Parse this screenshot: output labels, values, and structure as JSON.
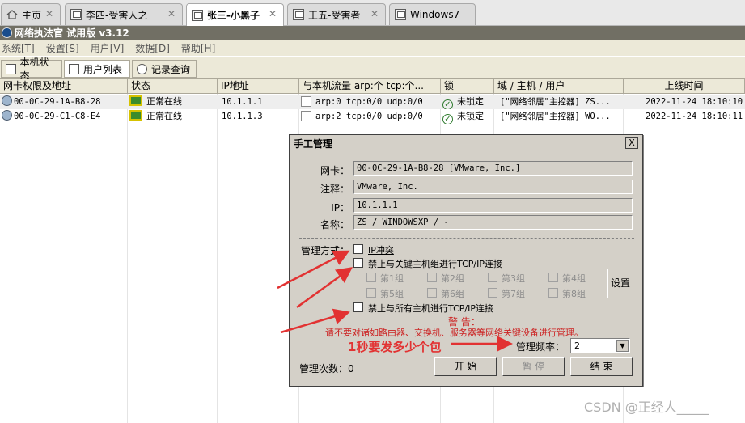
{
  "tabs": [
    {
      "label": "主页",
      "icon": "home-icon",
      "active": false
    },
    {
      "label": "李四-受害人之一",
      "icon": "vm-icon",
      "active": false
    },
    {
      "label": "张三-小黑子",
      "icon": "vm-icon",
      "active": true
    },
    {
      "label": "王五-受害者",
      "icon": "vm-icon",
      "active": false
    },
    {
      "label": "Windows7",
      "icon": "vm-icon",
      "active": false
    }
  ],
  "app": {
    "title": "网络执法官 试用版 v3.12"
  },
  "menu": [
    "系统[T]",
    "设置[S]",
    "用户[V]",
    "数据[D]",
    "帮助[H]"
  ],
  "toolbar": [
    "本机状态",
    "用户列表",
    "记录查询"
  ],
  "table": {
    "columns": [
      "网卡权限及地址",
      "状态",
      "IP地址",
      "与本机流量 arp:个 tcp:个...",
      "锁",
      "域 / 主机 / 用户",
      "上线时间"
    ],
    "rows": [
      {
        "mac": "00-0C-29-1A-B8-28",
        "status": "正常在线",
        "ip": "10.1.1.1",
        "traffic": "arp:0 tcp:0/0 udp:0/0",
        "lock": "未锁定",
        "host": "[\"网络邻居\"主控器] ZS...",
        "time": "2022-11-24 18:10:10"
      },
      {
        "mac": "00-0C-29-C1-C8-E4",
        "status": "正常在线",
        "ip": "10.1.1.3",
        "traffic": "arp:2 tcp:0/0 udp:0/0",
        "lock": "未锁定",
        "host": "[\"网络邻居\"主控器] WO...",
        "time": "2022-11-24 18:10:11"
      }
    ]
  },
  "dialog": {
    "title": "手工管理",
    "close": "X",
    "nic_label": "网卡：",
    "nic_value": "00-0C-29-1A-B8-28 [VMware, Inc.]",
    "note_label": "注释：",
    "note_value": "VMware, Inc.",
    "ip_label": "IP：",
    "ip_value": "10.1.1.1",
    "name_label": "名称：",
    "name_value": "ZS / WINDOWSXP / -",
    "mode_label": "管理方式：",
    "opt_ip_conflict": "IP冲突",
    "opt_block_key": "禁止与关键主机组进行TCP/IP连接",
    "groups": [
      "第1组",
      "第2组",
      "第3组",
      "第4组",
      "第5组",
      "第6组",
      "第7组",
      "第8组"
    ],
    "settings_button": "设置",
    "opt_block_all": "禁止与所有主机进行TCP/IP连接",
    "warn_title": "警 告：",
    "warn_text": "请不要对诸如路由器、交换机、服务器等网络关键设备进行管理。",
    "freq_label": "管理频率：",
    "freq_value": "2",
    "count_label": "管理次数：",
    "count_value": "0",
    "start": "开 始",
    "pause": "暂 停",
    "stop": "结 束"
  },
  "annotation": "1秒要发多少个包",
  "watermark": "CSDN @正经人_____",
  "colors": {
    "annotation": "#e23232",
    "warning": "#cc2222",
    "dialog_bg": "#d4d0c8"
  }
}
